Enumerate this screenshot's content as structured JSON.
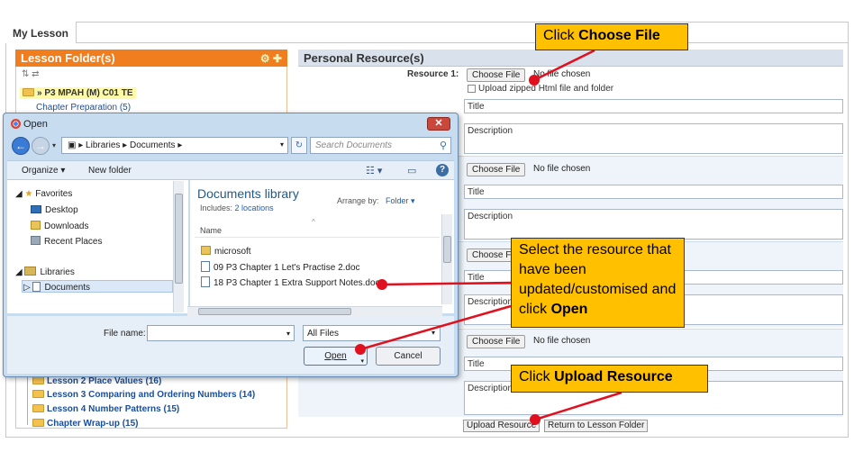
{
  "tab": {
    "label": "My Lesson"
  },
  "lesson_folder": {
    "header": "Lesson Folder(s)",
    "tools": "🔁📂",
    "root": "» P3 MPAH (M) C01 TE",
    "chapter_prep": "Chapter Preparation (5)",
    "items": [
      "Lesson 2 Place Values (16)",
      "Lesson 3 Comparing and Ordering Numbers (14)",
      "Lesson 4 Number Patterns (15)",
      "Chapter Wrap-up (15)"
    ]
  },
  "personal_resource": {
    "header": "Personal Resource(s)",
    "resource_label": "Resource 1:",
    "choose_file": "Choose File",
    "no_file": "No file chosen",
    "zip_label": "Upload zipped Html file and folder",
    "title_placeholder": "Title",
    "description_placeholder": "Description",
    "upload_button": "Upload Resource",
    "return_button": "Return to Lesson Folder"
  },
  "dialog": {
    "title": "Open",
    "address": {
      "segments": [
        "Libraries",
        "Documents"
      ]
    },
    "search_placeholder": "Search Documents",
    "toolbar": {
      "organize": "Organize ▾",
      "new_folder": "New folder"
    },
    "nav": {
      "favorites": "Favorites",
      "desktop": "Desktop",
      "downloads": "Downloads",
      "recent": "Recent Places",
      "libraries": "Libraries",
      "documents": "Documents"
    },
    "library": {
      "title": "Documents library",
      "includes_label": "Includes:",
      "includes_link": "2 locations",
      "arrange_label": "Arrange by:",
      "arrange_value": "Folder ▾",
      "column_name": "Name",
      "files": [
        {
          "name": "microsoft",
          "type": "folder"
        },
        {
          "name": "09 P3 Chapter 1 Let's Practise 2.doc",
          "type": "doc"
        },
        {
          "name": "18 P3 Chapter 1 Extra Support Notes.doc",
          "type": "doc"
        }
      ]
    },
    "file_name_label": "File name:",
    "file_name_value": "",
    "file_type": "All Files",
    "open_button": "Open",
    "cancel_button": "Cancel"
  },
  "callouts": {
    "choose_file": {
      "prefix": "Click ",
      "bold": "Choose File"
    },
    "select": {
      "text": "Select the resource that have been updated/customised and click ",
      "bold": "Open"
    },
    "upload": {
      "prefix": "Click ",
      "bold": "Upload Resource"
    }
  },
  "colors": {
    "callout": "#ffc000",
    "marker": "#e0101e",
    "folder_header": "#f07d1e"
  }
}
